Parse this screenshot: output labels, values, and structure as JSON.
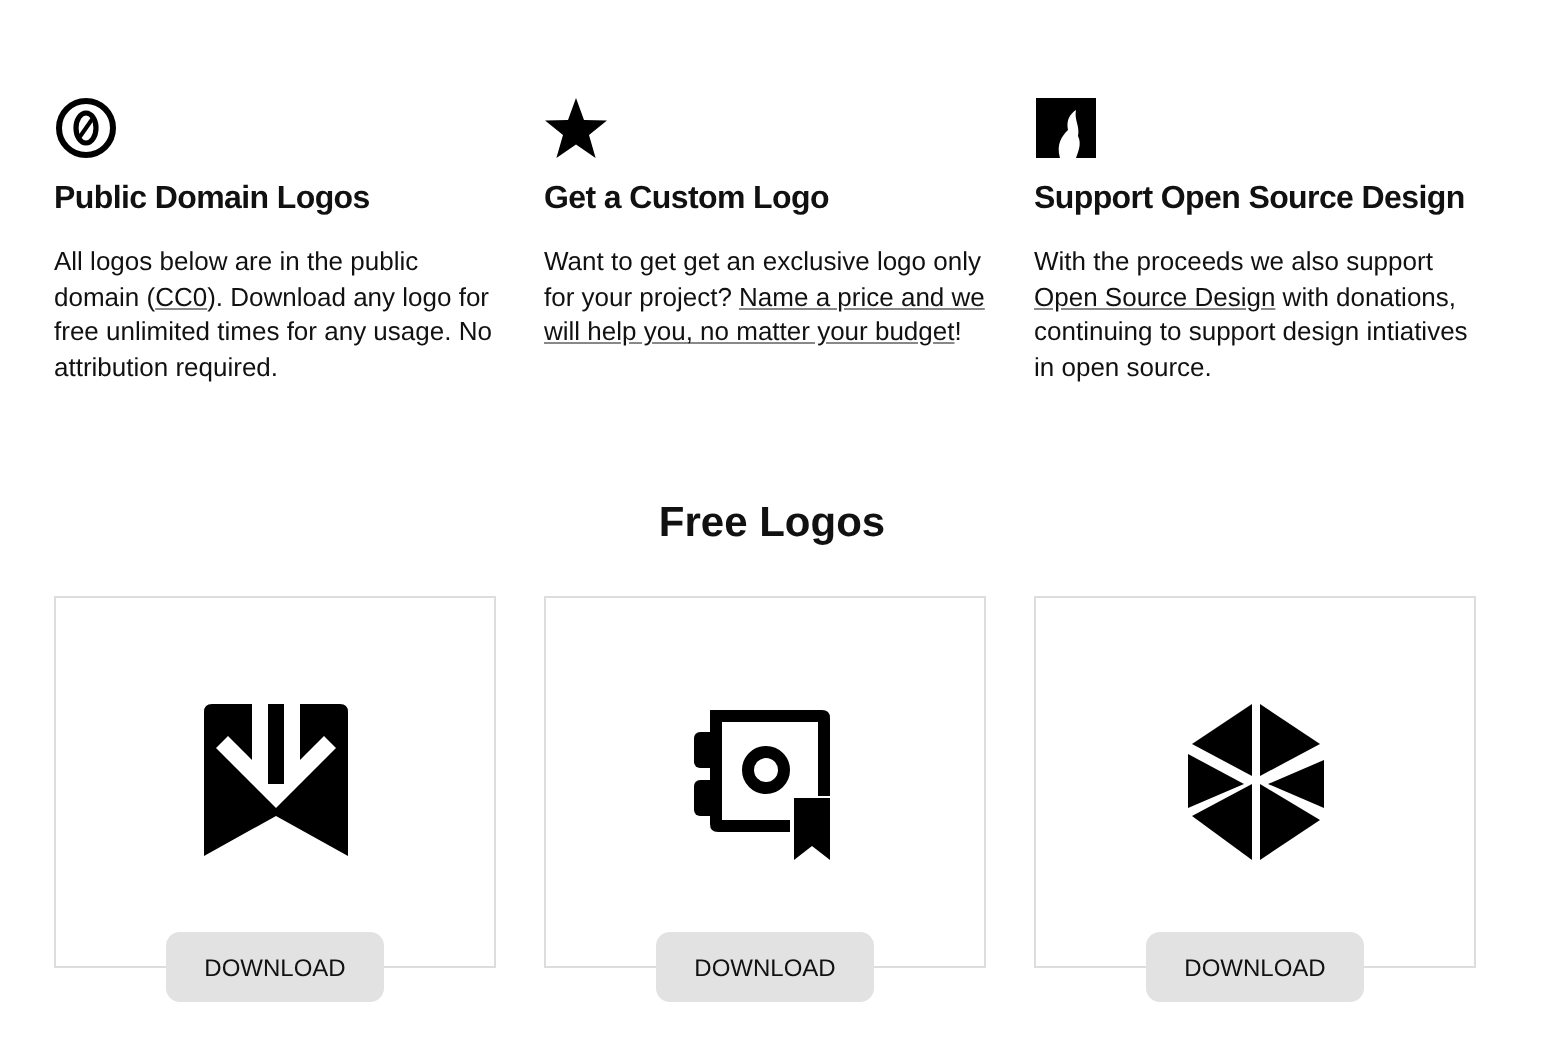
{
  "features": [
    {
      "kind": "zero",
      "title": "Public Domain Logos",
      "text": [
        {
          "kind": "text",
          "text": "All logos below are in the public domain ("
        },
        {
          "kind": "link",
          "text": "CC0"
        },
        {
          "kind": "text",
          "text": "). Download any logo for free unlimited times for any usage. No attribution required."
        }
      ]
    },
    {
      "kind": "star",
      "title": "Get a Custom Logo",
      "text": [
        {
          "kind": "text",
          "text": "Want to get get an exclusive logo only for your project? "
        },
        {
          "kind": "link",
          "text": "Name a price and we"
        },
        {
          "kind": "link",
          "text": "will help you, no matter your budget"
        },
        {
          "kind": "text",
          "text": "!"
        }
      ]
    },
    {
      "kind": "flame",
      "title": "Support Open Source Design",
      "text": [
        {
          "kind": "text",
          "text": "With the proceeds we also support "
        },
        {
          "kind": "link",
          "text": "Open Source Design"
        },
        {
          "kind": "text",
          "text": " with donations, continuing to support design intiatives in open source."
        }
      ]
    }
  ],
  "section_title": "Free Logos",
  "logos": [
    {
      "kind": "bookmark",
      "button": "DOWNLOAD"
    },
    {
      "kind": "safe",
      "button": "DOWNLOAD"
    },
    {
      "kind": "hexagon",
      "button": "DOWNLOAD"
    }
  ]
}
